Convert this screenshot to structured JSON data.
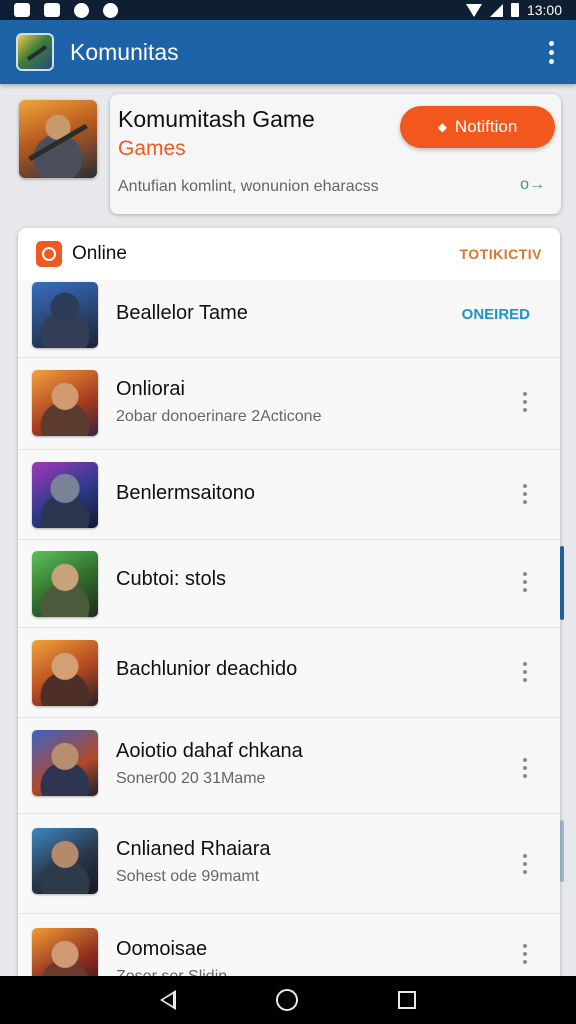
{
  "status_bar": {
    "time": "13:00"
  },
  "app_bar": {
    "title": "Komunitas",
    "logo_icon": "game-logo-icon"
  },
  "hero": {
    "title": "Komumitash Game",
    "subtitle": "Games",
    "description": "Antufian komlint, wonunion eharacss",
    "notify_button": "Notiftion",
    "go_link": "o→",
    "accent": "#f2581e"
  },
  "list": {
    "header_title": "Online",
    "header_link": "TOTIKICTIV",
    "rows": [
      {
        "name": "Beallelor Tame",
        "subtitle": "",
        "status": "ONEIRED"
      },
      {
        "name": "Onliorai",
        "subtitle": "2obar donoerinare 2Acticone",
        "status": ""
      },
      {
        "name": "Benlermsaitono",
        "subtitle": "",
        "status": ""
      },
      {
        "name": "Cubtoi: stols",
        "subtitle": "",
        "status": ""
      },
      {
        "name": "Bachlunior deachido",
        "subtitle": "",
        "status": ""
      },
      {
        "name": "Aoiotio dahaf chkana",
        "subtitle": "Soner00 20 31Mame",
        "status": ""
      },
      {
        "name": "Cnlianed Rhaiara",
        "subtitle": "Sohest ode 99mamt",
        "status": ""
      },
      {
        "name": "Oomoisae",
        "subtitle": "Zoser ser Slidin",
        "status": ""
      }
    ]
  },
  "colors": {
    "app_bar": "#1d63a8",
    "status_online": "#1c92c8",
    "header_link": "#e0742d"
  }
}
